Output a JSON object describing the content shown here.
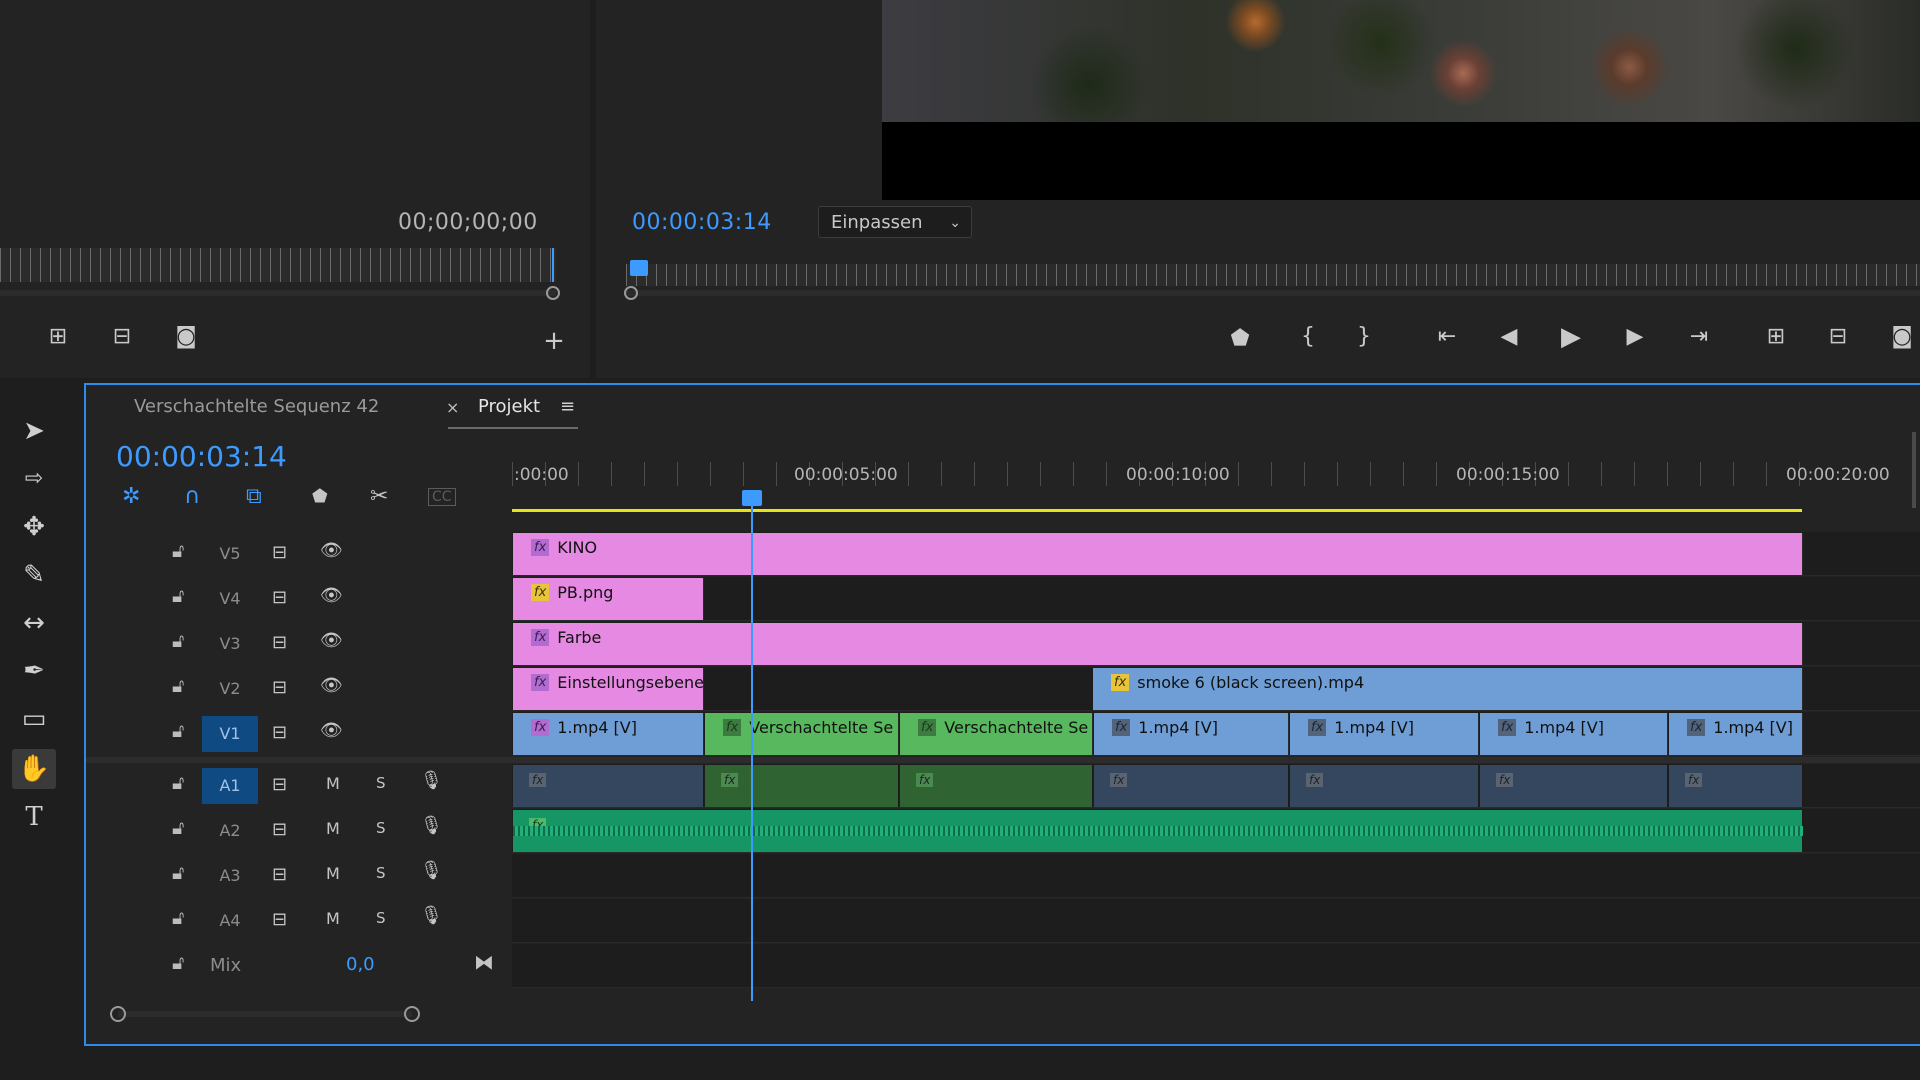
{
  "source_monitor": {
    "timecode": "00;00;00;00",
    "buttons": [
      "insert-icon",
      "overwrite-icon",
      "camera-icon",
      "plus-icon"
    ]
  },
  "program_monitor": {
    "timecode": "00:00:03:14",
    "fit_select": "Einpassen",
    "buttons": [
      "marker-icon",
      "mark-in-icon",
      "mark-out-icon",
      "go-to-in-icon",
      "step-back-icon",
      "play-icon",
      "step-forward-icon",
      "go-to-out-icon",
      "lift-icon",
      "extract-icon",
      "camera-icon"
    ]
  },
  "tools": [
    "selection",
    "track-select",
    "ripple",
    "razor",
    "slip",
    "pen",
    "rectangle",
    "hand",
    "type"
  ],
  "timeline": {
    "tabs": {
      "sequence": "Verschachtelte Sequenz 42",
      "close": "×",
      "project": "Projekt",
      "menu": "≡"
    },
    "timecode": "00:00:03:14",
    "ruler_labels": [
      ":00:00",
      "00:00:05:00",
      "00:00:10:00",
      "00:00:15:00",
      "00:00:20:00"
    ],
    "video_tracks": [
      {
        "name": "V5",
        "selected": false
      },
      {
        "name": "V4",
        "selected": false
      },
      {
        "name": "V3",
        "selected": false
      },
      {
        "name": "V2",
        "selected": false
      },
      {
        "name": "V1",
        "selected": true
      }
    ],
    "audio_tracks": [
      {
        "name": "A1",
        "selected": true,
        "m": "M",
        "s": "S"
      },
      {
        "name": "A2",
        "selected": false,
        "m": "M",
        "s": "S"
      },
      {
        "name": "A3",
        "selected": false,
        "m": "M",
        "s": "S"
      },
      {
        "name": "A4",
        "selected": false,
        "m": "M",
        "s": "S"
      }
    ],
    "mix": {
      "label": "Mix",
      "value": "0,0"
    },
    "clips": {
      "v5": "KINO",
      "v4": "PB.png",
      "v3": "Farbe",
      "v2a": "Einstellungsebene",
      "v2b": "smoke 6 (black screen).mp4",
      "v1": [
        "1.mp4 [V]",
        "Verschachtelte Se",
        "Verschachtelte Se",
        "1.mp4 [V]",
        "1.mp4 [V]",
        "1.mp4 [V]",
        "1.mp4 [V]"
      ]
    },
    "fx_label": "fx",
    "playhead_time": "00:00:03:14"
  }
}
